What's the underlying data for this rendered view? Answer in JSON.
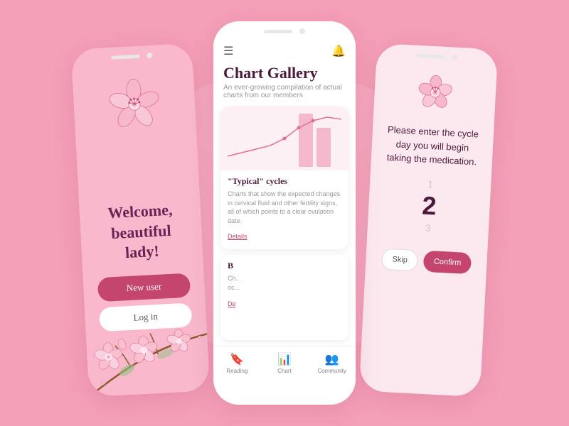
{
  "background_color": "#f4a0b8",
  "left_phone": {
    "welcome_line1": "Welcome,",
    "welcome_line2": "beautiful",
    "welcome_line3": "lady!",
    "btn_new_user": "New user",
    "btn_log_in": "Log in"
  },
  "center_phone": {
    "title": "Chart Gallery",
    "subtitle": "An ever-growing compilation of actual charts from our members",
    "card1": {
      "title": "\"Typical\" cycles",
      "description": "Charts that show the expected changes in cervical fluid and other fertility signs, all of which points to a clear ovulation date.",
      "details_link": "Details"
    },
    "card2": {
      "title": "B",
      "description": "Ch... oc...",
      "details_link": "De"
    },
    "nav": {
      "reading_label": "Reading",
      "chart_label": "Chart",
      "community_label": "Community"
    }
  },
  "right_phone": {
    "prompt": "Please enter the cycle day you will begin taking the medication.",
    "num_top": "1",
    "num_center": "2",
    "num_bottom": "3",
    "btn_skip": "Skip",
    "btn_confirm": "Confirm"
  },
  "icons": {
    "hamburger": "☰",
    "bell": "🔔",
    "reading_icon": "📖",
    "chart_icon": "📊",
    "community_icon": "👥",
    "flower": "🌸"
  }
}
